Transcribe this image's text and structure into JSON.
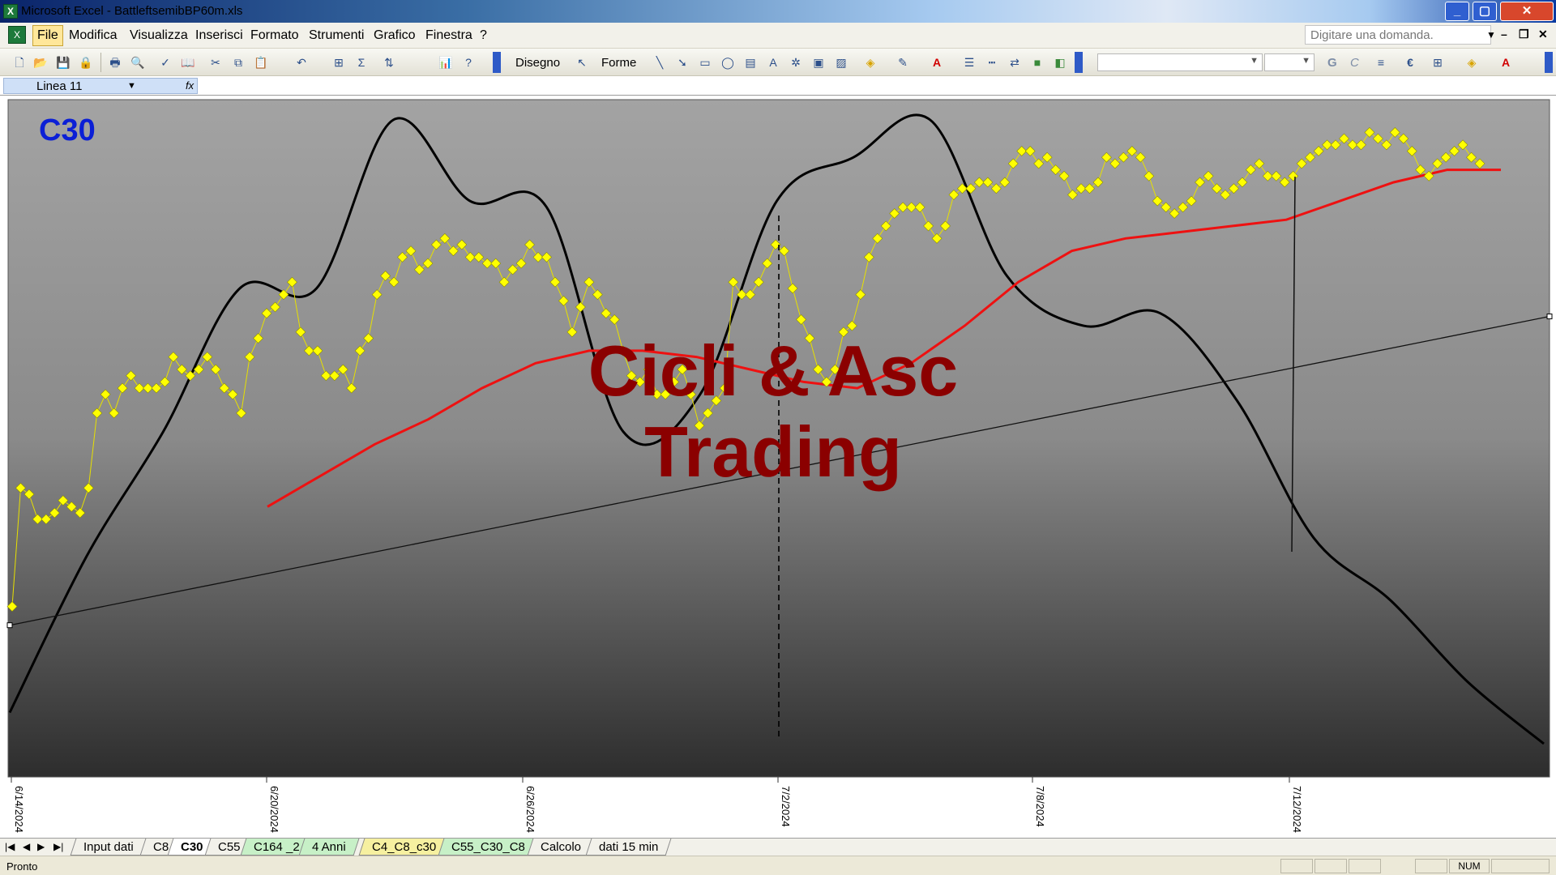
{
  "window": {
    "title": "Microsoft Excel - BattleftsemibBP60m.xls",
    "app_icon": "excel-icon"
  },
  "menu": {
    "items": [
      "File",
      "Modifica",
      "Visualizza",
      "Inserisci",
      "Formato",
      "Strumenti",
      "Grafico",
      "Finestra",
      "?"
    ],
    "active": "File",
    "help_placeholder": "Digitare una domanda."
  },
  "toolbar": {
    "draw_label": "Disegno",
    "shapes_label": "Forme",
    "bold_label": "G",
    "italic_label": "C"
  },
  "namebox": {
    "value": "Linea 11",
    "fx_label": "fx"
  },
  "chart": {
    "corner_label": "C30",
    "watermark_line1": "Cicli & Asc",
    "watermark_line2": "Trading",
    "x_tick_labels": [
      "6/14/2024",
      "6/20/2024",
      "6/26/2024",
      "7/2/2024",
      "7/8/2024",
      "7/12/2024"
    ],
    "colors": {
      "price": "#ffff00",
      "price_line": "#e7e000",
      "moving_average": "#ee1111",
      "cycle": "#000000",
      "trend": "#111111",
      "corner_label": "#0b1fd6",
      "watermark": "#8b0000"
    }
  },
  "chart_data": {
    "type": "line",
    "title": "",
    "xlabel": "",
    "ylabel": "",
    "x_axis": "date",
    "x_ticks": [
      "6/14/2024",
      "6/20/2024",
      "6/26/2024",
      "7/2/2024",
      "7/8/2024",
      "7/12/2024"
    ],
    "series": [
      {
        "name": "",
        "style": "yellow diamond markers with thin line",
        "values": [
          0.27,
          0.46,
          0.45,
          0.41,
          0.41,
          0.42,
          0.44,
          0.43,
          0.42,
          0.46,
          0.58,
          0.61,
          0.58,
          0.62,
          0.64,
          0.62,
          0.62,
          0.62,
          0.63,
          0.67,
          0.65,
          0.64,
          0.65,
          0.67,
          0.65,
          0.62,
          0.61,
          0.58,
          0.67,
          0.7,
          0.74,
          0.75,
          0.77,
          0.79,
          0.71,
          0.68,
          0.68,
          0.64,
          0.64,
          0.65,
          0.62,
          0.68,
          0.7,
          0.77,
          0.8,
          0.79,
          0.83,
          0.84,
          0.81,
          0.82,
          0.85,
          0.86,
          0.84,
          0.85,
          0.83,
          0.83,
          0.82,
          0.82,
          0.79,
          0.81,
          0.82,
          0.85,
          0.83,
          0.83,
          0.79,
          0.76,
          0.71,
          0.75,
          0.79,
          0.77,
          0.74,
          0.73,
          0.68,
          0.64,
          0.63,
          0.65,
          0.61,
          0.61,
          0.63,
          0.65,
          0.61,
          0.56,
          0.58,
          0.6,
          0.62,
          0.79,
          0.77,
          0.77,
          0.79,
          0.82,
          0.85,
          0.84,
          0.78,
          0.73,
          0.7,
          0.65,
          0.63,
          0.65,
          0.71,
          0.72,
          0.77,
          0.83,
          0.86,
          0.88,
          0.9,
          0.91,
          0.91,
          0.91,
          0.88,
          0.86,
          0.88,
          0.93,
          0.94,
          0.94,
          0.95,
          0.95,
          0.94,
          0.95,
          0.98,
          1.0,
          1.0,
          0.98,
          0.99,
          0.97,
          0.96,
          0.93,
          0.94,
          0.94,
          0.95,
          0.99,
          0.98,
          0.99,
          1.0,
          0.99,
          0.96,
          0.92,
          0.91,
          0.9,
          0.91,
          0.92,
          0.95,
          0.96,
          0.94,
          0.93,
          0.94,
          0.95,
          0.97,
          0.98,
          0.96,
          0.96,
          0.95,
          0.96,
          0.98,
          0.99,
          1.0,
          1.01,
          1.01,
          1.02,
          1.01,
          1.01,
          1.03,
          1.02,
          1.01,
          1.03,
          1.02,
          1.0,
          0.97,
          0.96,
          0.98,
          0.99,
          1.0,
          1.01,
          0.99,
          0.98
        ]
      },
      {
        "name": "",
        "style": "red moving average",
        "values": [
          0.43,
          0.48,
          0.53,
          0.57,
          0.62,
          0.66,
          0.68,
          0.68,
          0.67,
          0.65,
          0.63,
          0.62,
          0.66,
          0.72,
          0.79,
          0.84,
          0.86,
          0.87,
          0.88,
          0.89,
          0.92,
          0.95,
          0.97,
          0.97
        ]
      },
      {
        "name": "",
        "style": "black cycle curve",
        "values": [
          0.1,
          0.35,
          0.55,
          0.78,
          0.78,
          1.05,
          0.92,
          0.91,
          0.55,
          0.61,
          0.92,
          0.99,
          1.05,
          0.8,
          0.72,
          0.74,
          0.6,
          0.38,
          0.28,
          0.15,
          0.05
        ]
      }
    ],
    "annotations": [
      {
        "type": "trendline",
        "from": "6/14/2024",
        "to": "end"
      },
      {
        "type": "vertical_dashed",
        "at": "7/2/2024"
      },
      {
        "type": "vertical_solid",
        "at": "7/12/2024"
      }
    ],
    "legend": "none",
    "grid": false,
    "background": "gradient grey"
  },
  "sheets": {
    "tabs": [
      "Input dati",
      "C8",
      "C30",
      "C55",
      "C164 _2",
      "4 Anni",
      "C4_C8_c30",
      "C55_C30_C8",
      "Calcolo",
      "dati 15 min"
    ],
    "active": "C30",
    "tab_colors": [
      "#f2f1ea",
      "#f2f1ea",
      "#ffffff",
      "#f2f1ea",
      "#c7f0c7",
      "#c7f0c7",
      "#f6f0a0",
      "#c7f0c7",
      "#f2f1ea",
      "#f2f1ea"
    ]
  },
  "status": {
    "text": "Pronto",
    "num_label": "NUM"
  }
}
